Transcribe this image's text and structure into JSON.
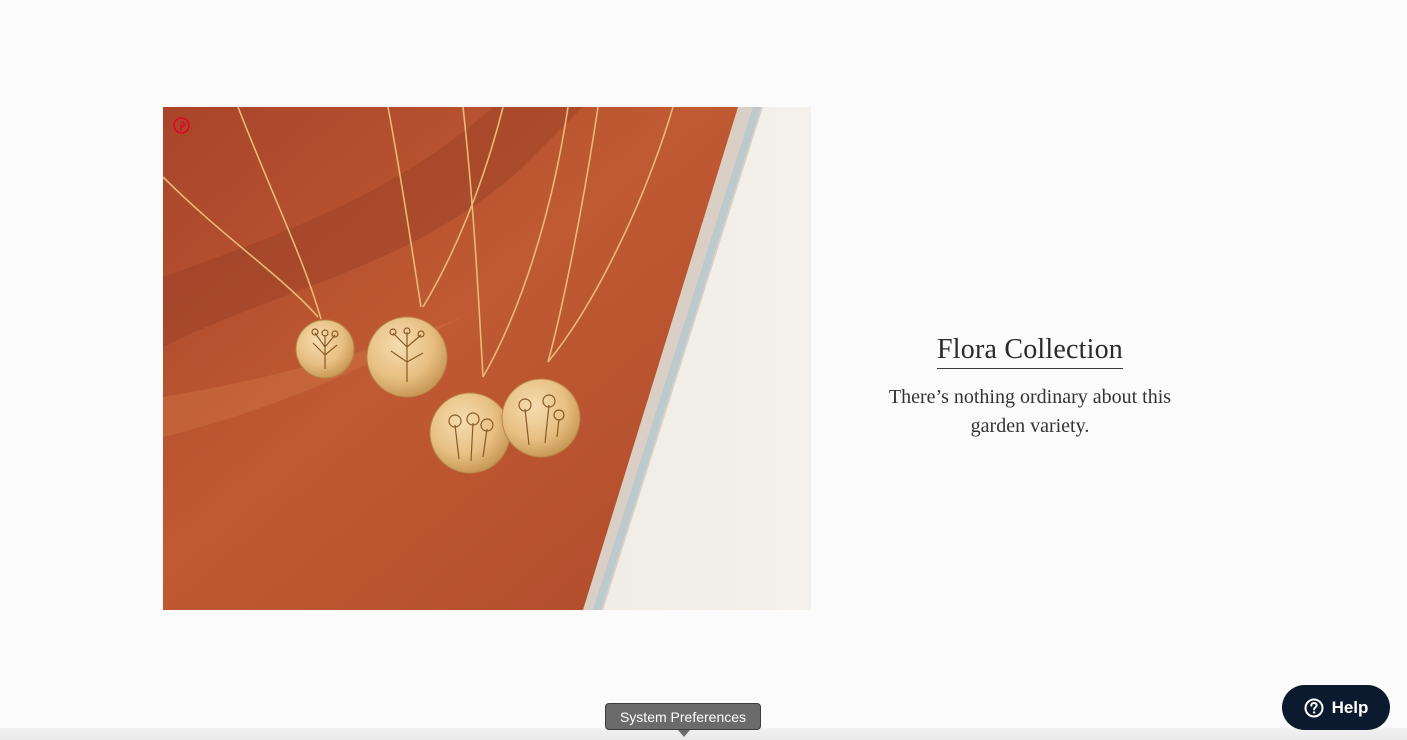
{
  "collection": {
    "title": "Flora Collection",
    "description": "There’s nothing ordinary about this garden variety."
  },
  "image": {
    "pin_icon": "pinterest-icon"
  },
  "help_button": {
    "label": "Help",
    "icon": "question-circle-icon"
  },
  "tooltip": {
    "text": "System Preferences"
  },
  "colors": {
    "background": "#fbfbfb",
    "help_bg": "#0b1a2e",
    "photo_terracotta": "#b8532e",
    "pin_red": "#e60023"
  }
}
